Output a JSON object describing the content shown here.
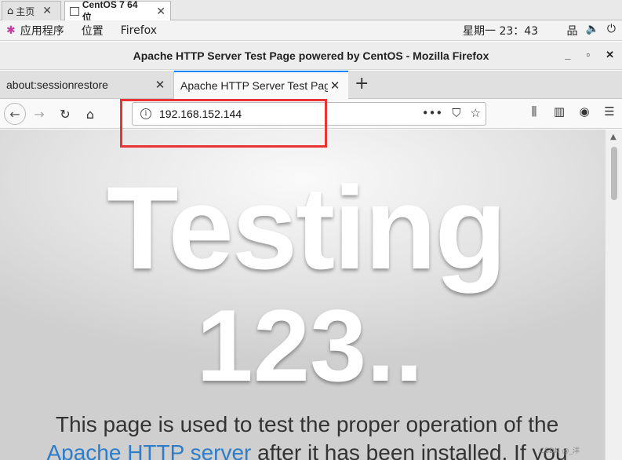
{
  "vm_tabs": [
    {
      "label": "主页",
      "icon": "home-icon"
    },
    {
      "label": "CentOS 7 64 位",
      "icon": "vm-icon"
    }
  ],
  "gnome": {
    "apps": "应用程序",
    "places": "位置",
    "firefox": "Firefox",
    "clock": "星期一 23：43"
  },
  "window": {
    "title": "Apache HTTP Server Test Page powered by CentOS - Mozilla Firefox",
    "minimize": "_",
    "maximize": "▫",
    "close": "✕"
  },
  "tabs": [
    {
      "label": "about:sessionrestore",
      "active": false
    },
    {
      "label": "Apache HTTP Server Test Page powered by CentOS",
      "active": true
    }
  ],
  "urlbar": {
    "url": "192.168.152.144"
  },
  "page": {
    "heading_line1": "Testing",
    "heading_line2": "123..",
    "para_start": "This page is used to test the proper operation of the",
    "para_link": "Apache HTTP server",
    "para_end": " after it has been installed. If you"
  },
  "watermark": "CSDN @_洋",
  "colors": {
    "highlight": "#e83434",
    "link": "#2e7dc9",
    "tab_accent": "#0a84ff"
  }
}
